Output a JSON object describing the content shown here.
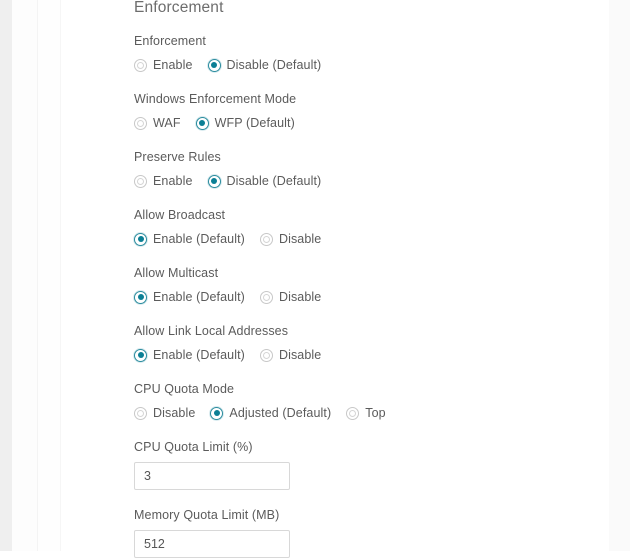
{
  "section": {
    "title": "Enforcement"
  },
  "colors": {
    "accent": "#0b7f95",
    "accent_ring": "#2b8c9e",
    "label_text": "#5b5b5b",
    "title_text": "#6d6d6d",
    "input_border": "#d8d8d8",
    "radio_off_border": "#c8c8c8",
    "page_background": "#ffffff",
    "left_rail": "#efefef",
    "right_rail": "#fafafa"
  },
  "fields": [
    {
      "name": "enforcement",
      "label": "Enforcement",
      "type": "radio",
      "options": [
        {
          "label": "Enable",
          "selected": false
        },
        {
          "label": "Disable (Default)",
          "selected": true
        }
      ]
    },
    {
      "name": "windows-enforcement-mode",
      "label": "Windows Enforcement Mode",
      "type": "radio",
      "options": [
        {
          "label": "WAF",
          "selected": false
        },
        {
          "label": "WFP (Default)",
          "selected": true
        }
      ]
    },
    {
      "name": "preserve-rules",
      "label": "Preserve Rules",
      "type": "radio",
      "options": [
        {
          "label": "Enable",
          "selected": false
        },
        {
          "label": "Disable (Default)",
          "selected": true
        }
      ]
    },
    {
      "name": "allow-broadcast",
      "label": "Allow Broadcast",
      "type": "radio",
      "options": [
        {
          "label": "Enable (Default)",
          "selected": true
        },
        {
          "label": "Disable",
          "selected": false
        }
      ]
    },
    {
      "name": "allow-multicast",
      "label": "Allow Multicast",
      "type": "radio",
      "options": [
        {
          "label": "Enable (Default)",
          "selected": true
        },
        {
          "label": "Disable",
          "selected": false
        }
      ]
    },
    {
      "name": "allow-link-local-addresses",
      "label": "Allow Link Local Addresses",
      "type": "radio",
      "options": [
        {
          "label": "Enable (Default)",
          "selected": true
        },
        {
          "label": "Disable",
          "selected": false
        }
      ]
    },
    {
      "name": "cpu-quota-mode",
      "label": "CPU Quota Mode",
      "type": "radio",
      "options": [
        {
          "label": "Disable",
          "selected": false
        },
        {
          "label": "Adjusted (Default)",
          "selected": true
        },
        {
          "label": "Top",
          "selected": false
        }
      ]
    },
    {
      "name": "cpu-quota-limit",
      "label": "CPU Quota Limit (%)",
      "type": "text",
      "value": "3",
      "placeholder": ""
    },
    {
      "name": "memory-quota-limit",
      "label": "Memory Quota Limit (MB)",
      "type": "text",
      "value": "512",
      "placeholder": ""
    }
  ]
}
